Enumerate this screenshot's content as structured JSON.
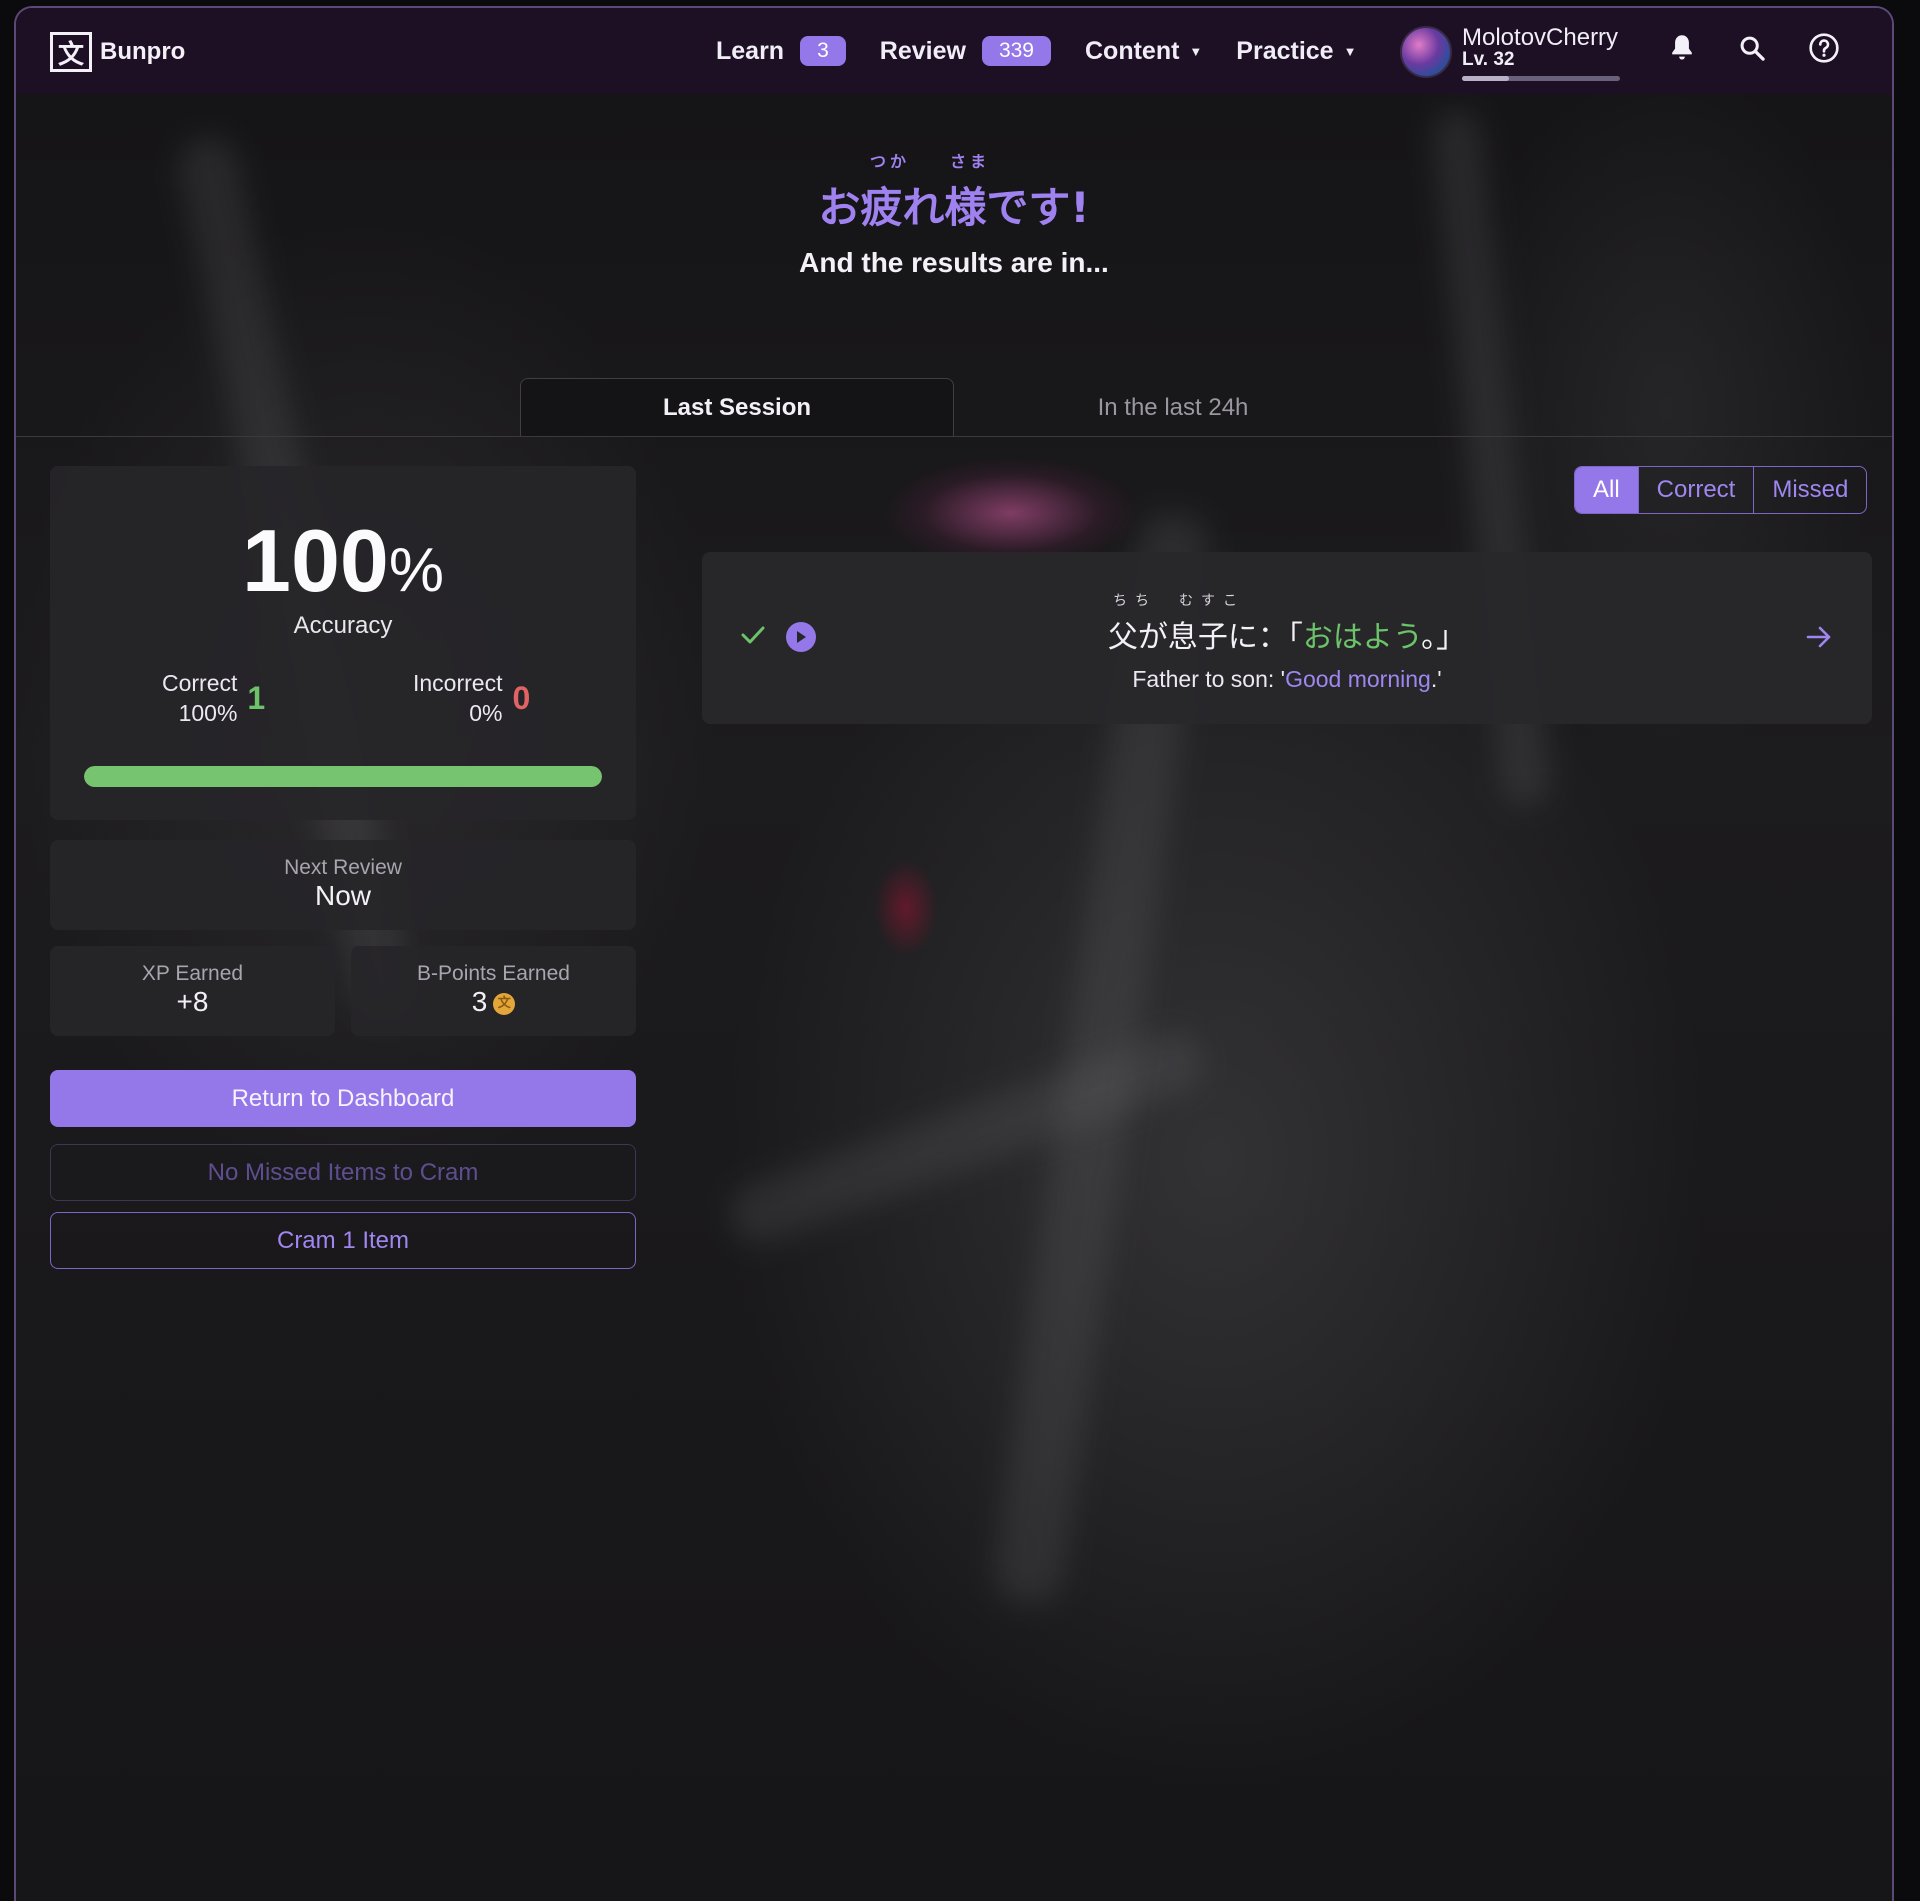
{
  "brand": {
    "name": "Bunpro",
    "icon": "bunpro-logo-icon",
    "glyph": "文"
  },
  "nav": {
    "learn": {
      "label": "Learn",
      "count": "3"
    },
    "review": {
      "label": "Review",
      "count": "339"
    },
    "content": {
      "label": "Content"
    },
    "practice": {
      "label": "Practice"
    }
  },
  "user": {
    "name": "MolotovCherry",
    "level": "Lv. 32",
    "xp_progress": 0.3
  },
  "icons": [
    "bell-icon",
    "search-icon",
    "help-icon"
  ],
  "header": {
    "ruby_1": "つか",
    "ruby_2": "さま",
    "title": "お疲れ様です!",
    "subtitle": "And the results are in..."
  },
  "tabs": {
    "last_session": "Last Session",
    "last_24h": "In the last 24h"
  },
  "accuracy": {
    "value": "100",
    "percent_sign": "%",
    "label": "Accuracy",
    "correct_label": "Correct",
    "correct_pct": "100%",
    "correct_count": "1",
    "incorrect_label": "Incorrect",
    "incorrect_pct": "0%",
    "incorrect_count": "0",
    "bar_fraction": 1.0
  },
  "next_review": {
    "label": "Next Review",
    "value": "Now"
  },
  "xp": {
    "label": "XP Earned",
    "value": "+8"
  },
  "bpoints": {
    "label": "B-Points Earned",
    "value": "3",
    "coin_glyph": "文"
  },
  "buttons": {
    "dashboard": "Return to Dashboard",
    "no_missed": "No Missed Items to Cram",
    "cram": "Cram 1 Item"
  },
  "filters": {
    "all": "All",
    "correct": "Correct",
    "missed": "Missed",
    "selected": "All"
  },
  "results": [
    {
      "status": "correct",
      "ruby_father": "ちち",
      "ruby_son": "むすこ",
      "jp_before": "父が息子に：「",
      "jp_grammar": "おはよう",
      "jp_after": "。」",
      "en_before": "Father to son: '",
      "en_grammar": "Good morning",
      "en_after": ".'"
    }
  ],
  "colors": {
    "accent": "#9477e8",
    "navbar": "#1d0f24",
    "correct": "#6cc36a",
    "incorrect": "#e06464"
  }
}
